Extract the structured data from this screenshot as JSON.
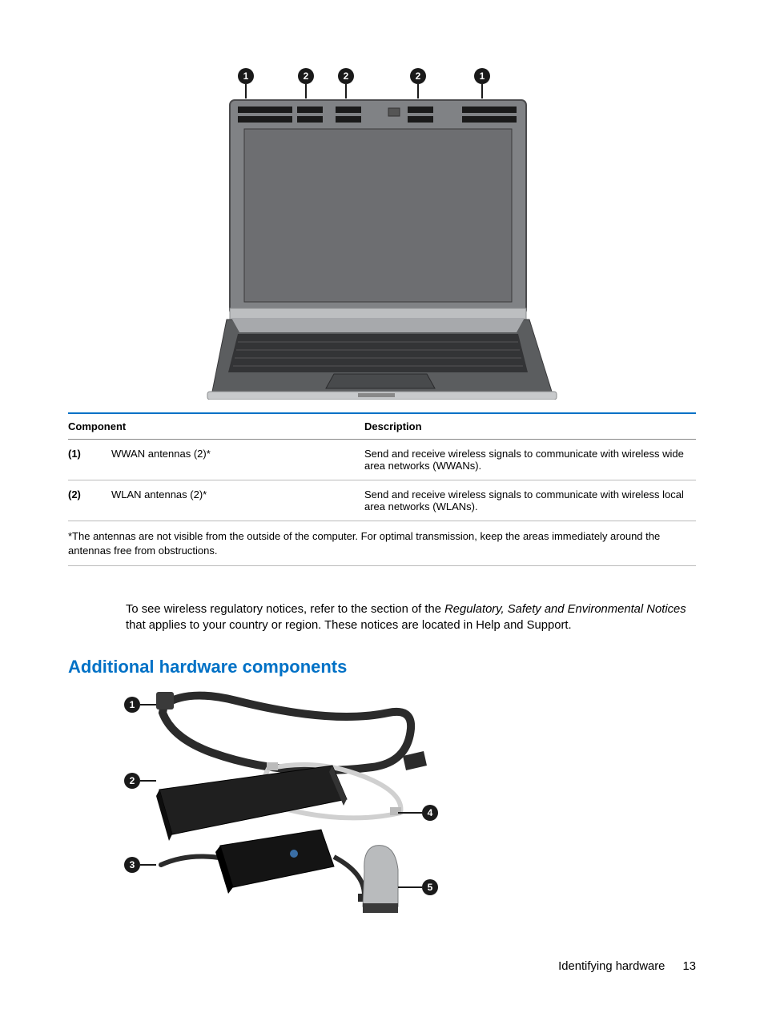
{
  "figure1": {
    "callouts": [
      "1",
      "2",
      "2",
      "2",
      "1"
    ]
  },
  "table": {
    "head_component": "Component",
    "head_description": "Description",
    "rows": [
      {
        "idx": "(1)",
        "component": "WWAN antennas (2)*",
        "description": "Send and receive wireless signals to communicate with wireless wide area networks (WWANs)."
      },
      {
        "idx": "(2)",
        "component": "WLAN antennas (2)*",
        "description": "Send and receive wireless signals to communicate with wireless local area networks (WLANs)."
      }
    ],
    "footnote": "*The antennas are not visible from the outside of the computer. For optimal transmission, keep the areas immediately around the antennas free from obstructions."
  },
  "paragraph": {
    "pre": "To see wireless regulatory notices, refer to the section of the ",
    "italic": "Regulatory, Safety and Environmental Notices",
    "post": " that applies to your country or region. These notices are located in Help and Support."
  },
  "heading": "Additional hardware components",
  "figure2": {
    "callouts": [
      "1",
      "2",
      "3",
      "4",
      "5"
    ]
  },
  "footer": {
    "section": "Identifying hardware",
    "page": "13"
  }
}
